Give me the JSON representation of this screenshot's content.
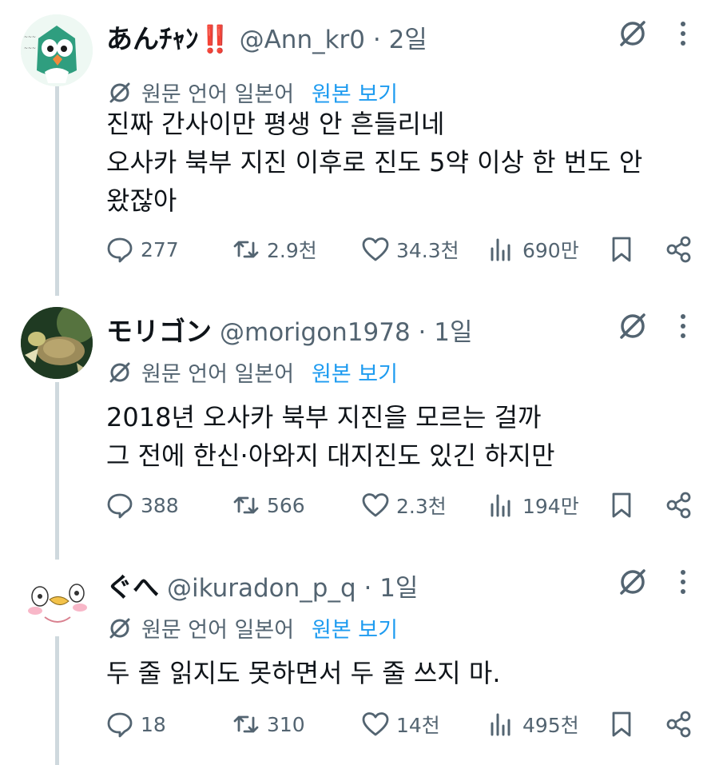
{
  "translate": {
    "language_label": "원문 언어 일본어",
    "show_original": "원본 보기"
  },
  "tweets": [
    {
      "display_name": "あんﾁｬﾝ‼️",
      "handle": "@Ann_kr0 · 2일",
      "lines": [
        "진짜 간사이만 평생 안 흔들리네",
        "오사카 북부 지진 이후로 진도 5약 이상 한 번도 안",
        "왔잖아"
      ],
      "replies": "277",
      "reposts": "2.9천",
      "likes": "34.3천",
      "views": "690만"
    },
    {
      "display_name": "モリゴン",
      "handle": "@morigon1978 · 1일",
      "lines": [
        "2018년 오사카 북부 지진을 모르는 걸까",
        "그 전에 한신·아와지 대지진도 있긴 하지만"
      ],
      "replies": "388",
      "reposts": "566",
      "likes": "2.3천",
      "views": "194만"
    },
    {
      "display_name": "ぐへ",
      "handle": "@ikuradon_p_q · 1일",
      "lines": [
        "두 줄 읽지도 못하면서 두 줄 쓰지 마."
      ],
      "replies": "18",
      "reposts": "310",
      "likes": "14천",
      "views": "495천"
    }
  ],
  "colors": {
    "text": "#0f1419",
    "secondary": "#536471",
    "link": "#1d9bf0",
    "thread_line": "#cfd9de"
  }
}
